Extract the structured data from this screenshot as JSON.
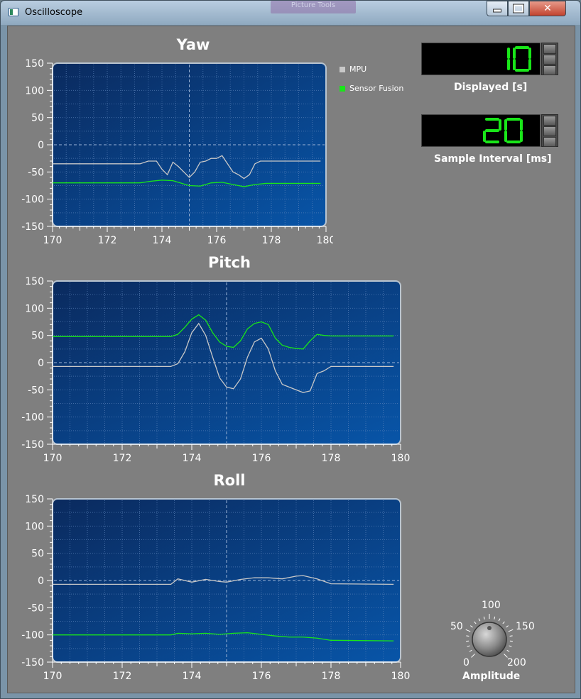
{
  "window": {
    "title": "Oscilloscope",
    "background_tab": "Picture Tools",
    "close_glyph": "✕"
  },
  "legend": [
    {
      "label": "MPU",
      "color": "#c8c8c8"
    },
    {
      "label": "Sensor Fusion",
      "color": "#19e619"
    }
  ],
  "displayed": {
    "value": "10",
    "label": "Displayed [s]"
  },
  "sample_interval": {
    "value": "20",
    "label": "Sample Interval [ms]"
  },
  "amplitude": {
    "label": "Amplitude",
    "value": 100,
    "ticks": [
      "0",
      "50",
      "100",
      "150",
      "200"
    ]
  },
  "colors": {
    "plot_top": "#0a2a5e",
    "plot_bottom": "#0855a8",
    "mpu": "#c8c8c8",
    "fusion": "#19e619",
    "lcd_digit": "#19e619"
  },
  "chart_data": [
    {
      "type": "line",
      "title": "Yaw",
      "xlim": [
        170,
        180
      ],
      "ylim": [
        -150,
        150
      ],
      "xticks": [
        "170",
        "172",
        "174",
        "176",
        "178",
        "180"
      ],
      "yticks": [
        "150",
        "100",
        "50",
        "0",
        "-50",
        "-100",
        "-150"
      ],
      "series": [
        {
          "name": "MPU",
          "color": "#c8c8c8",
          "x": [
            170,
            173.2,
            173.5,
            173.8,
            174.0,
            174.2,
            174.4,
            174.6,
            174.8,
            175.0,
            175.2,
            175.4,
            175.6,
            175.8,
            176.0,
            176.2,
            176.4,
            176.6,
            176.8,
            177.0,
            177.2,
            177.4,
            177.6,
            178.0,
            179.8
          ],
          "y": [
            -35,
            -35,
            -30,
            -30,
            -45,
            -55,
            -32,
            -40,
            -50,
            -60,
            -50,
            -32,
            -30,
            -25,
            -25,
            -20,
            -35,
            -50,
            -55,
            -62,
            -55,
            -35,
            -30,
            -30,
            -30
          ]
        },
        {
          "name": "Sensor Fusion",
          "color": "#19e619",
          "x": [
            170,
            173.2,
            173.6,
            174.0,
            174.4,
            174.8,
            175.0,
            175.4,
            175.8,
            176.2,
            176.6,
            177.0,
            177.4,
            177.8,
            179.8
          ],
          "y": [
            -70,
            -70,
            -67,
            -65,
            -66,
            -72,
            -75,
            -76,
            -70,
            -69,
            -73,
            -77,
            -73,
            -71,
            -71
          ]
        }
      ]
    },
    {
      "type": "line",
      "title": "Pitch",
      "xlim": [
        170,
        180
      ],
      "ylim": [
        -150,
        150
      ],
      "xticks": [
        "170",
        "172",
        "174",
        "176",
        "178",
        "180"
      ],
      "yticks": [
        "150",
        "100",
        "50",
        "0",
        "-50",
        "-100",
        "-150"
      ],
      "series": [
        {
          "name": "MPU",
          "color": "#c8c8c8",
          "x": [
            170,
            173.4,
            173.6,
            173.8,
            174.0,
            174.2,
            174.4,
            174.6,
            174.8,
            175.0,
            175.2,
            175.4,
            175.6,
            175.8,
            176.0,
            176.2,
            176.4,
            176.6,
            176.8,
            177.0,
            177.2,
            177.4,
            177.6,
            177.8,
            178.0,
            179.8
          ],
          "y": [
            -7,
            -7,
            -2,
            20,
            55,
            72,
            50,
            10,
            -28,
            -45,
            -48,
            -30,
            10,
            38,
            45,
            25,
            -15,
            -40,
            -45,
            -50,
            -55,
            -52,
            -20,
            -15,
            -7,
            -7
          ]
        },
        {
          "name": "Sensor Fusion",
          "color": "#19e619",
          "x": [
            170,
            173.4,
            173.6,
            173.8,
            174.0,
            174.2,
            174.4,
            174.6,
            174.8,
            175.0,
            175.2,
            175.4,
            175.6,
            175.8,
            176.0,
            176.2,
            176.4,
            176.6,
            176.8,
            177.0,
            177.2,
            177.4,
            177.6,
            177.8,
            178.0,
            179.8
          ],
          "y": [
            48,
            48,
            52,
            65,
            80,
            88,
            78,
            55,
            38,
            30,
            28,
            40,
            62,
            72,
            75,
            70,
            45,
            32,
            28,
            26,
            25,
            40,
            52,
            50,
            49,
            49
          ]
        }
      ]
    },
    {
      "type": "line",
      "title": "Roll",
      "xlim": [
        170,
        180
      ],
      "ylim": [
        -150,
        150
      ],
      "xticks": [
        "170",
        "172",
        "174",
        "176",
        "178",
        "180"
      ],
      "yticks": [
        "150",
        "100",
        "50",
        "0",
        "-50",
        "-100",
        "-150"
      ],
      "series": [
        {
          "name": "MPU",
          "color": "#c8c8c8",
          "x": [
            170,
            173.4,
            173.6,
            174.0,
            174.4,
            174.8,
            175.0,
            175.4,
            175.8,
            176.2,
            176.6,
            177.0,
            177.2,
            177.6,
            178.0,
            179.8
          ],
          "y": [
            -7,
            -7,
            3,
            -3,
            2,
            -2,
            -3,
            2,
            5,
            5,
            3,
            8,
            9,
            3,
            -6,
            -7
          ]
        },
        {
          "name": "Sensor Fusion",
          "color": "#19e619",
          "x": [
            170,
            173.4,
            173.6,
            174.0,
            174.4,
            174.8,
            175.2,
            175.6,
            176.0,
            176.4,
            176.8,
            177.2,
            177.6,
            178.0,
            179.8
          ],
          "y": [
            -100,
            -100,
            -97,
            -98,
            -97,
            -99,
            -97,
            -96,
            -99,
            -102,
            -104,
            -104,
            -106,
            -110,
            -111
          ]
        }
      ]
    }
  ]
}
